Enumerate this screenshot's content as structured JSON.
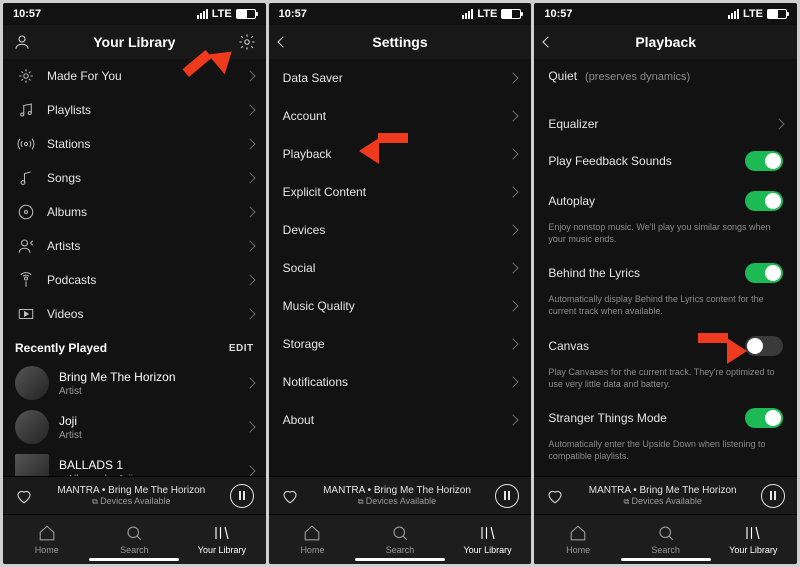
{
  "status": {
    "time": "10:57",
    "carrier": "LTE"
  },
  "library": {
    "title": "Your Library",
    "items": [
      {
        "label": "Made For You",
        "icon": "sparkle-icon"
      },
      {
        "label": "Playlists",
        "icon": "note-icon"
      },
      {
        "label": "Stations",
        "icon": "radio-icon"
      },
      {
        "label": "Songs",
        "icon": "song-icon"
      },
      {
        "label": "Albums",
        "icon": "album-icon"
      },
      {
        "label": "Artists",
        "icon": "artist-icon"
      },
      {
        "label": "Podcasts",
        "icon": "podcast-icon"
      },
      {
        "label": "Videos",
        "icon": "video-icon"
      }
    ],
    "recently_title": "Recently Played",
    "edit": "EDIT",
    "recent": [
      {
        "title": "Bring Me The Horizon",
        "sub": "Artist",
        "round": true
      },
      {
        "title": "Joji",
        "sub": "Artist",
        "round": true
      },
      {
        "title": "BALLADS 1",
        "sub": "Album • by Joji",
        "dl": true
      }
    ]
  },
  "settings": {
    "title": "Settings",
    "items": [
      "Data Saver",
      "Account",
      "Playback",
      "Explicit Content",
      "Devices",
      "Social",
      "Music Quality",
      "Storage",
      "Notifications",
      "About"
    ]
  },
  "playback": {
    "title": "Playback",
    "quiet": "Quiet",
    "quiet_sub": "(preserves dynamics)",
    "rows": [
      {
        "label": "Equalizer",
        "type": "nav"
      },
      {
        "label": "Play Feedback Sounds",
        "type": "sw",
        "on": true
      },
      {
        "label": "Autoplay",
        "type": "sw",
        "on": true,
        "desc": "Enjoy nonstop music. We'll play you similar songs when your music ends."
      },
      {
        "label": "Behind the Lyrics",
        "type": "sw",
        "on": true,
        "desc": "Automatically display Behind the Lyrics content for the current track when available."
      },
      {
        "label": "Canvas",
        "type": "sw",
        "on": false,
        "desc": "Play Canvases for the current track. They're optimized to use very little data and battery."
      },
      {
        "label": "Stranger Things Mode",
        "type": "sw",
        "on": true,
        "desc": "Automatically enter the Upside Down when listening to compatible playlists."
      }
    ]
  },
  "now_playing": {
    "track": "MANTRA",
    "sep": " • ",
    "artist": "Bring Me The Horizon",
    "devices": "Devices Available"
  },
  "tabs": [
    {
      "label": "Home",
      "icon": "home-icon"
    },
    {
      "label": "Search",
      "icon": "search-icon"
    },
    {
      "label": "Your Library",
      "icon": "library-icon"
    }
  ]
}
